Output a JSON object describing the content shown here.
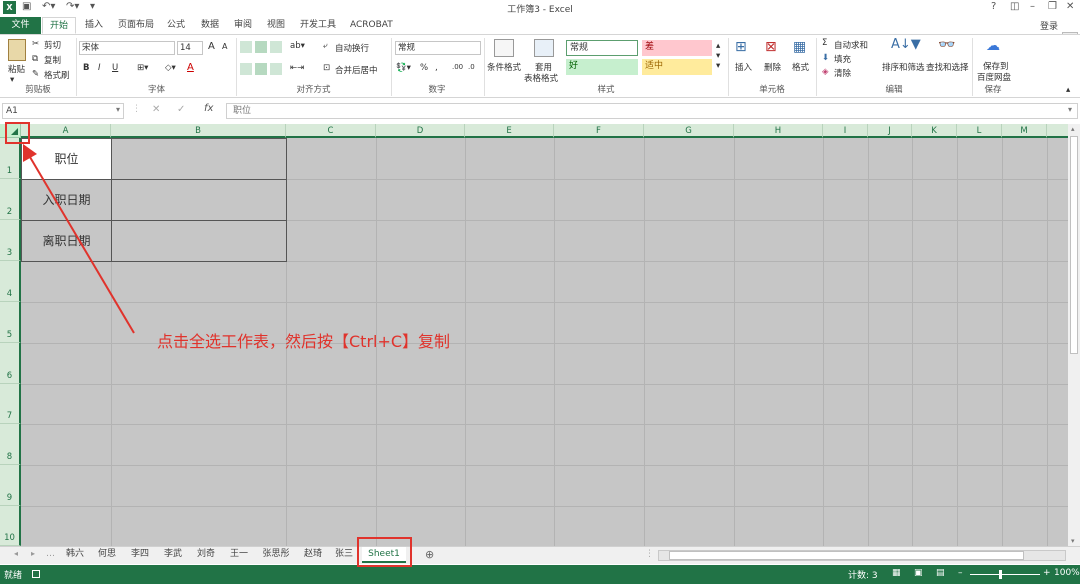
{
  "window": {
    "title": "工作簿3 - Excel",
    "login": "登录"
  },
  "ribbon_tabs": [
    "文件",
    "开始",
    "插入",
    "页面布局",
    "公式",
    "数据",
    "审阅",
    "视图",
    "开发工具",
    "ACROBAT"
  ],
  "clipboard": {
    "paste": "粘贴",
    "cut": "剪切",
    "copy": "复制",
    "format_painter": "格式刷",
    "label": "剪贴板"
  },
  "font": {
    "name": "宋体",
    "size": "14",
    "bold": "B",
    "italic": "I",
    "underline": "U",
    "grow": "A",
    "shrink": "A",
    "font_color": "A",
    "label": "字体"
  },
  "alignment": {
    "wrap": "自动换行",
    "merge": "合并后居中",
    "label": "对齐方式"
  },
  "number": {
    "format": "常规",
    "percent": "%",
    "label": "数字"
  },
  "styles": {
    "cond": "条件格式",
    "table": "套用",
    "table2": "表格格式",
    "normal": "常规",
    "bad": "差",
    "good": "好",
    "neutral": "适中",
    "label": "样式"
  },
  "cells": {
    "insert": "插入",
    "delete": "删除",
    "format": "格式",
    "label": "单元格"
  },
  "editing": {
    "autosum": "自动求和",
    "fill": "填充",
    "clear": "清除",
    "sort": "排序和筛选",
    "find": "查找和选择",
    "label": "编辑"
  },
  "save_group": {
    "save1": "保存到",
    "save2": "百度网盘",
    "label": "保存"
  },
  "formula_bar": {
    "name_box": "A1",
    "fx": "fx",
    "content": "职位"
  },
  "columns": [
    "A",
    "B",
    "C",
    "D",
    "E",
    "F",
    "G",
    "H",
    "I",
    "J",
    "K",
    "L",
    "M"
  ],
  "rows": [
    "1",
    "2",
    "3",
    "4",
    "5",
    "6",
    "7",
    "8",
    "9",
    "10"
  ],
  "cells_data": {
    "a1": "职位",
    "a2": "入职日期",
    "a3": "离职日期"
  },
  "sheets": [
    "韩六",
    "何思",
    "李四",
    "李武",
    "刘奇",
    "王一",
    "张思彤",
    "赵琦",
    "张三",
    "Sheet1"
  ],
  "status": {
    "ready": "就绪",
    "count": "计数: 3",
    "zoom": "100%"
  },
  "annotation": "点击全选工作表，然后按【Ctrl+C】复制",
  "colors": {
    "accent": "#217346",
    "annotation": "#e0332c"
  }
}
